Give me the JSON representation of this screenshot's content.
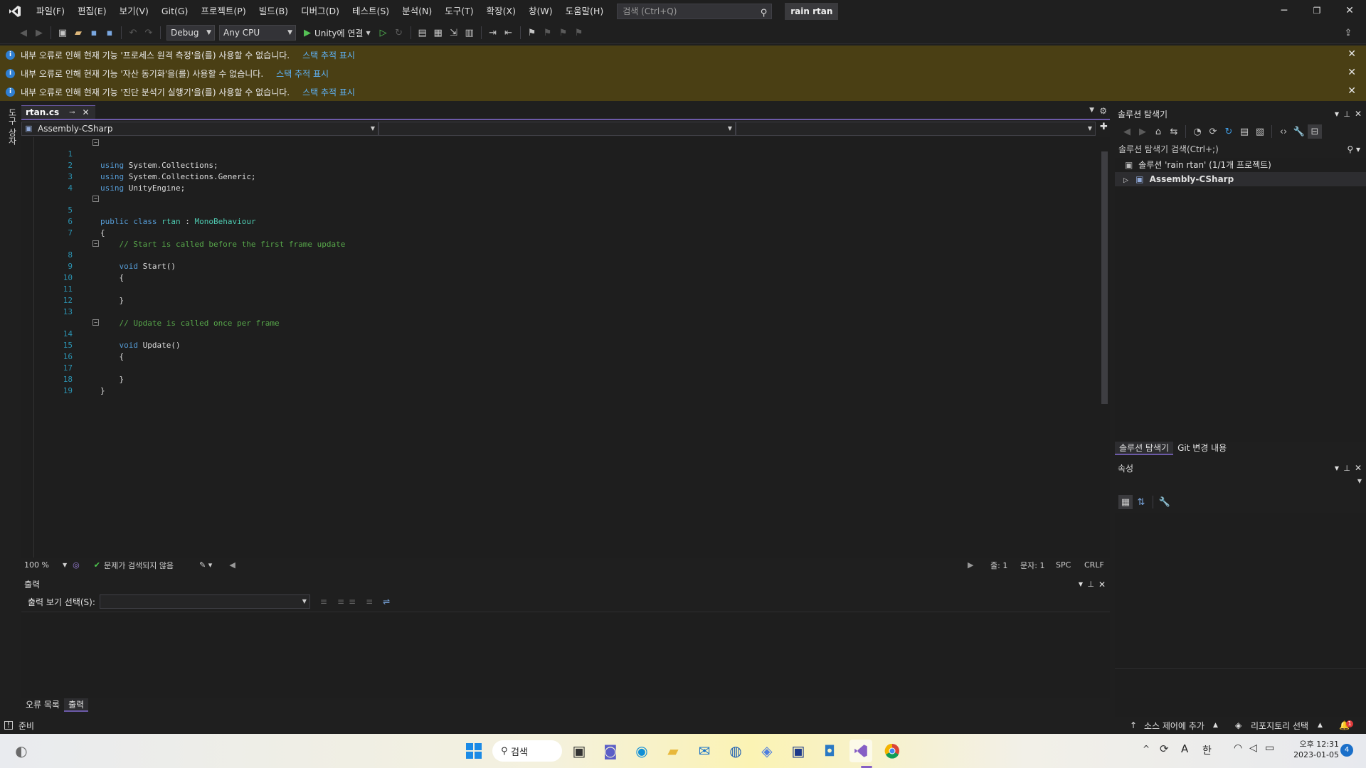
{
  "titlebar": {
    "menus": [
      "파일(F)",
      "편집(E)",
      "보기(V)",
      "Git(G)",
      "프로젝트(P)",
      "빌드(B)",
      "디버그(D)",
      "테스트(S)",
      "분석(N)",
      "도구(T)",
      "확장(X)",
      "창(W)",
      "도움말(H)"
    ],
    "search_placeholder": "검색 (Ctrl+Q)",
    "username": "rain rtan"
  },
  "toolbar": {
    "config": "Debug",
    "platform": "Any CPU",
    "run_label": "Unity에 연결"
  },
  "infobars": [
    {
      "message": "내부 오류로 인해 현재 기능 '프로세스 원격 측정'을(를) 사용할 수 없습니다.",
      "link": "스택 추적 표시"
    },
    {
      "message": "내부 오류로 인해 현재 기능 '자산 동기화'을(를) 사용할 수 없습니다.",
      "link": "스택 추적 표시"
    },
    {
      "message": "내부 오류로 인해 현재 기능 '진단 분석기 실행기'을(를) 사용할 수 없습니다.",
      "link": "스택 추적 표시"
    }
  ],
  "leftrail": {
    "label": "도구 상자"
  },
  "editor": {
    "tab_name": "rtan.cs",
    "project_combo": "Assembly-CSharp",
    "lines": [
      {
        "n": "1",
        "code": "using System.Collections;"
      },
      {
        "n": "2",
        "code": "using System.Collections.Generic;"
      },
      {
        "n": "3",
        "code": "using UnityEngine;"
      },
      {
        "n": "4",
        "code": ""
      },
      {
        "n": "5",
        "code": "public class rtan : MonoBehaviour"
      },
      {
        "n": "6",
        "code": "{"
      },
      {
        "n": "7",
        "code": "    // Start is called before the first frame update"
      },
      {
        "n": "8",
        "code": "    void Start()"
      },
      {
        "n": "9",
        "code": "    {"
      },
      {
        "n": "10",
        "code": ""
      },
      {
        "n": "11",
        "code": "    }"
      },
      {
        "n": "12",
        "code": ""
      },
      {
        "n": "13",
        "code": "    // Update is called once per frame"
      },
      {
        "n": "14",
        "code": "    void Update()"
      },
      {
        "n": "15",
        "code": "    {"
      },
      {
        "n": "16",
        "code": ""
      },
      {
        "n": "17",
        "code": "    }"
      },
      {
        "n": "18",
        "code": "}"
      },
      {
        "n": "19",
        "code": ""
      }
    ],
    "zoom": "100 %",
    "issues": "문제가 검색되지 않음",
    "line_pos": "줄: 1",
    "col_pos": "문자: 1",
    "whitespace": "SPC",
    "line_ending": "CRLF"
  },
  "output": {
    "title": "출력",
    "source_label": "출력 보기 선택(S):",
    "tabs": [
      "오류 목록",
      "출력"
    ]
  },
  "solution": {
    "title": "솔루션 탐색기",
    "search_placeholder": "솔루션 탐색기 검색(Ctrl+;)",
    "root": "솔루션 'rain rtan' (1/1개 프로젝트)",
    "project": "Assembly-CSharp",
    "tabs": [
      "솔루션 탐색기",
      "Git 변경 내용"
    ]
  },
  "properties": {
    "title": "속성"
  },
  "statusbar": {
    "ready": "준비",
    "source_control": "소스 제어에 추가",
    "repo": "리포지토리 선택",
    "notif_count": "1"
  },
  "taskbar": {
    "search": "검색",
    "ampm": "오후",
    "time": "12:31",
    "date": "2023-01-05",
    "ime": "한",
    "ime2": "A",
    "badge": "4"
  }
}
